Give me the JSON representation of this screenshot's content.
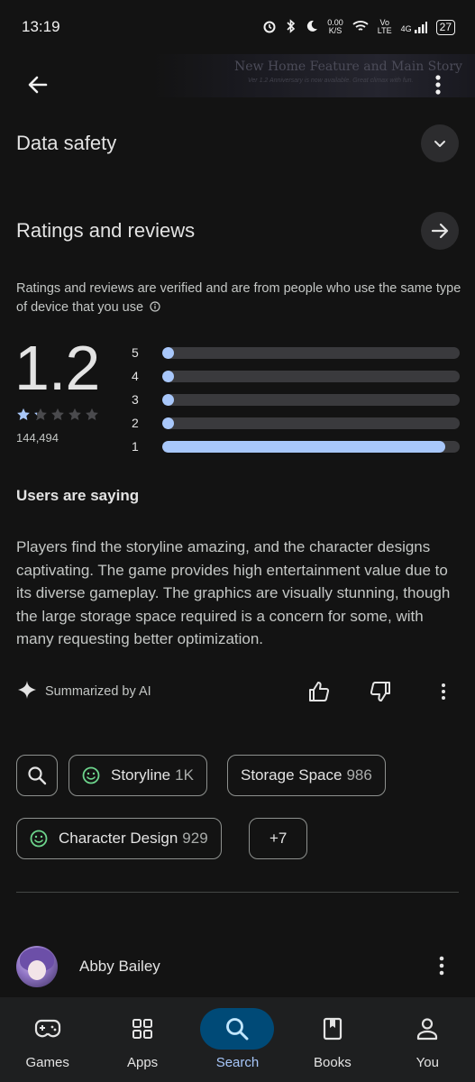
{
  "status_bar": {
    "time": "13:19",
    "net_speed_value": "0.00",
    "net_speed_unit": "K/S",
    "volte_top": "Vo",
    "volte_bottom": "LTE",
    "signal_label": "4G",
    "battery": "27"
  },
  "banner": {
    "title": "New Home Feature and Main Story",
    "subtitle": "Ver 1.2 Anniversary is now available. Great climax with fun."
  },
  "data_safety": {
    "title": "Data safety"
  },
  "ratings": {
    "title": "Ratings and reviews",
    "note": "Ratings and reviews are verified and are from people who use the same type of device that you use",
    "score": "1.2",
    "score_value": 1.2,
    "review_count": "144,494",
    "distribution": [
      {
        "label": "5",
        "fraction": 0.02
      },
      {
        "label": "4",
        "fraction": 0.02
      },
      {
        "label": "3",
        "fraction": 0.02
      },
      {
        "label": "2",
        "fraction": 0.02
      },
      {
        "label": "1",
        "fraction": 0.95
      }
    ]
  },
  "users_saying": {
    "title": "Users are saying",
    "summary": "Players find the storyline amazing, and the character designs captivating. The game provides high entertainment value due to its diverse gameplay. The graphics are visually stunning, though the large storage space required is a concern for some, with many requesting better optimization.",
    "ai_label": "Summarized by AI"
  },
  "chips": [
    {
      "label": "Storyline",
      "count": "1K",
      "icon": "smile-icon"
    },
    {
      "label": "Storage Space",
      "count": "986"
    },
    {
      "label": "Character Design",
      "count": "929",
      "icon": "smile-icon"
    },
    {
      "label": "+7"
    }
  ],
  "reviewer": {
    "name": "Abby Bailey"
  },
  "nav": [
    {
      "label": "Games",
      "icon": "gamepad-icon"
    },
    {
      "label": "Apps",
      "icon": "apps-grid-icon"
    },
    {
      "label": "Search",
      "icon": "search-icon",
      "active": true
    },
    {
      "label": "Books",
      "icon": "book-icon"
    },
    {
      "label": "You",
      "icon": "person-icon"
    }
  ],
  "colors": {
    "background": "#131313",
    "accent": "#a8c7fa",
    "active_nav_pill": "#004a77",
    "positive_icon": "#6dd58c"
  }
}
